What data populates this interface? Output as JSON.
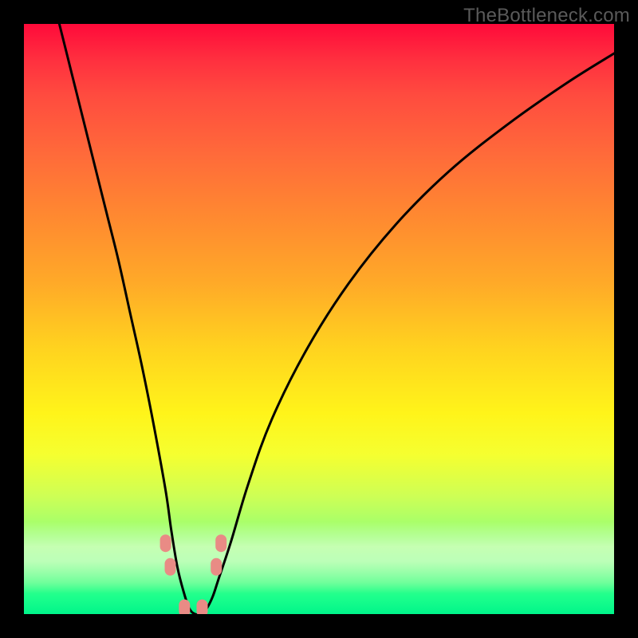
{
  "watermark": "TheBottleneck.com",
  "chart_data": {
    "type": "line",
    "title": "",
    "xlabel": "",
    "ylabel": "",
    "xlim": [
      0,
      100
    ],
    "ylim": [
      0,
      100
    ],
    "grid": false,
    "legend": false,
    "background_gradient": {
      "direction": "vertical",
      "stops": [
        {
          "pos": 0,
          "color": "#ff0a3a"
        },
        {
          "pos": 25,
          "color": "#ff7a33"
        },
        {
          "pos": 55,
          "color": "#ffe21f"
        },
        {
          "pos": 80,
          "color": "#b9ff5e"
        },
        {
          "pos": 100,
          "color": "#00f58a"
        }
      ]
    },
    "series": [
      {
        "name": "bottleneck-curve",
        "color": "#000000",
        "x": [
          6,
          8,
          10,
          12,
          14,
          16,
          18,
          20,
          22,
          24,
          25,
          26,
          27,
          28,
          29,
          30,
          31,
          32,
          33,
          35,
          38,
          42,
          48,
          55,
          63,
          72,
          82,
          92,
          100
        ],
        "y": [
          100,
          92,
          84,
          76,
          68,
          60,
          51,
          42,
          32,
          21,
          14,
          8,
          4,
          1,
          0,
          0,
          1,
          3,
          6,
          12,
          22,
          33,
          45,
          56,
          66,
          75,
          83,
          90,
          95
        ]
      }
    ],
    "markers": [
      {
        "name": "marker-left-up",
        "x": 24.0,
        "y": 12,
        "color": "#e98b85"
      },
      {
        "name": "marker-left-mid",
        "x": 24.8,
        "y": 8,
        "color": "#e98b85"
      },
      {
        "name": "marker-bottom-l",
        "x": 27.2,
        "y": 1,
        "color": "#e98b85"
      },
      {
        "name": "marker-bottom-r",
        "x": 30.2,
        "y": 1,
        "color": "#e98b85"
      },
      {
        "name": "marker-right-mid",
        "x": 32.6,
        "y": 8,
        "color": "#e98b85"
      },
      {
        "name": "marker-right-up",
        "x": 33.4,
        "y": 12,
        "color": "#e98b85"
      }
    ],
    "minimum_point": {
      "x": 29,
      "y": 0
    }
  }
}
